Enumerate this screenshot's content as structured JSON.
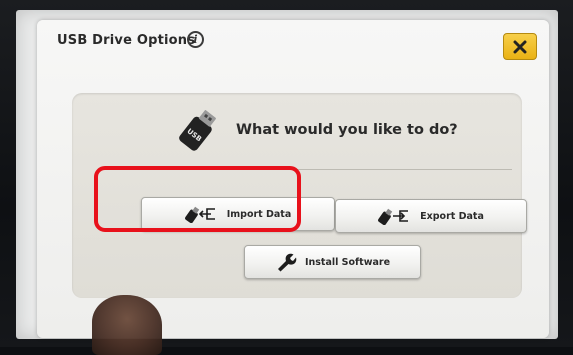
{
  "dialog": {
    "title": "USB Drive Options",
    "info_icon": "info-icon",
    "close_icon": "close-icon",
    "accent_color": "#eab215"
  },
  "panel": {
    "question": "What would you like to do?",
    "usb_icon": "usb-drive-icon",
    "usb_text": "USB"
  },
  "buttons": {
    "import_label": "Import Data",
    "export_label": "Export Data",
    "install_label": "Install Software",
    "import_icon": "usb-import-icon",
    "export_icon": "usb-export-icon",
    "install_icon": "wrench-icon"
  },
  "annotation": {
    "highlight_color": "#e8111b",
    "highlighted_item": "Import Data"
  }
}
